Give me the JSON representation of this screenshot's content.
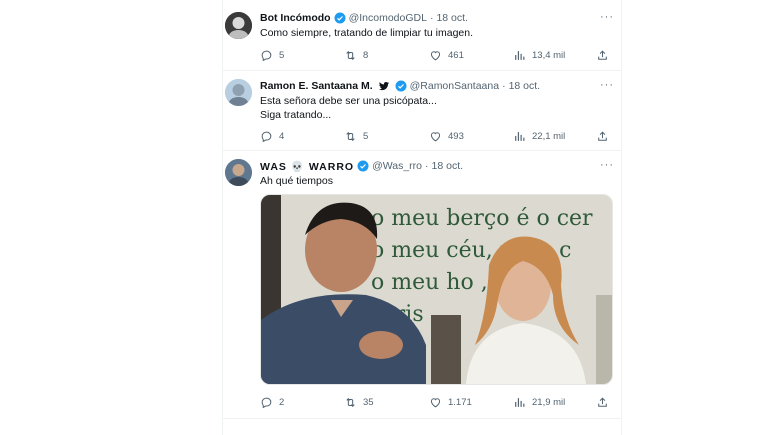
{
  "tweets": [
    {
      "name": "Bot Incómodo",
      "handle": "@IncomodoGDL",
      "date": "18 oct.",
      "lines": [
        "Como siempre, tratando de limpiar tu imagen."
      ],
      "replies": "5",
      "retweets": "8",
      "likes": "461",
      "views": "13,4 mil"
    },
    {
      "name": "Ramon E. Santaana M.",
      "handle": "@RamonSantaana",
      "date": "18 oct.",
      "lines": [
        "Esta señora debe ser una psicópata...",
        "Siga tratando..."
      ],
      "replies": "4",
      "retweets": "5",
      "likes": "493",
      "views": "22,1 mil"
    },
    {
      "name": "WAS 💀 WARRO",
      "handle": "@Was_rro",
      "date": "18 oct.",
      "lines": [
        "Ah qué tiempos"
      ],
      "replies": "2",
      "retweets": "35",
      "likes": "1.171",
      "views": "21,9 mil",
      "image_banner": [
        "o meu berço é o cer",
        "o meu céu,  mais c",
        "o meu ho         , o",
        "orris"
      ]
    }
  ],
  "icons": {
    "verified": "verified-badge-icon",
    "bird": "twitter-bird-icon",
    "reply": "reply-icon",
    "retweet": "retweet-icon",
    "like": "heart-icon",
    "views": "views-chart-icon",
    "share": "share-icon",
    "more": "more-icon"
  },
  "colors": {
    "verified": "#1d9bf0",
    "secondary": "#536471",
    "text": "#0f1419"
  }
}
